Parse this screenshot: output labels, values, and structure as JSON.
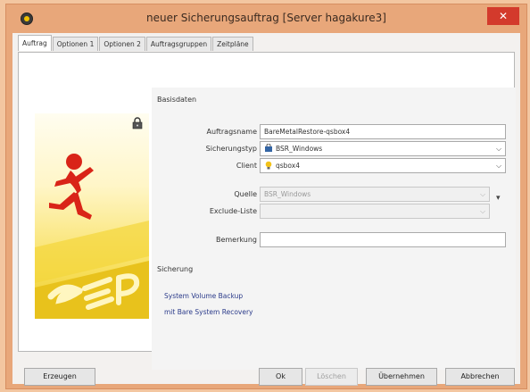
{
  "window": {
    "title": "neuer Sicherungsauftrag [Server hagakure3]",
    "close_glyph": "✕"
  },
  "tabs": [
    {
      "label": "Auftrag",
      "active": true
    },
    {
      "label": "Optionen 1",
      "active": false
    },
    {
      "label": "Optionen 2",
      "active": false
    },
    {
      "label": "Auftragsgruppen",
      "active": false
    },
    {
      "label": "Zeitpläne",
      "active": false
    }
  ],
  "basisdaten": {
    "heading": "Basisdaten",
    "auftragsname": {
      "label": "Auftragsname",
      "value": "BareMetalRestore-qsbox4"
    },
    "sicherungstyp": {
      "label": "Sicherungstyp",
      "value": "BSR_Windows"
    },
    "client": {
      "label": "Client",
      "value": "qsbox4"
    },
    "quelle": {
      "label": "Quelle",
      "value": "BSR_Windows"
    },
    "exclude": {
      "label": "Exclude-Liste",
      "value": ""
    },
    "bemerkung": {
      "label": "Bemerkung",
      "value": ""
    }
  },
  "sicherung": {
    "heading": "Sicherung",
    "line1": "System Volume Backup",
    "line2": "mit Bare System Recovery"
  },
  "buttons": {
    "erzeugen": "Erzeugen",
    "ok": "Ok",
    "loeschen": "Löschen",
    "uebernehmen": "Übernehmen",
    "abbrechen": "Abbrechen"
  },
  "colors": {
    "title_bar": "#e8a77a",
    "close_button": "#d33a2c",
    "link_text": "#2b3b8a",
    "hero_yellow": "#f3d63a",
    "mascot_red": "#d92418"
  }
}
